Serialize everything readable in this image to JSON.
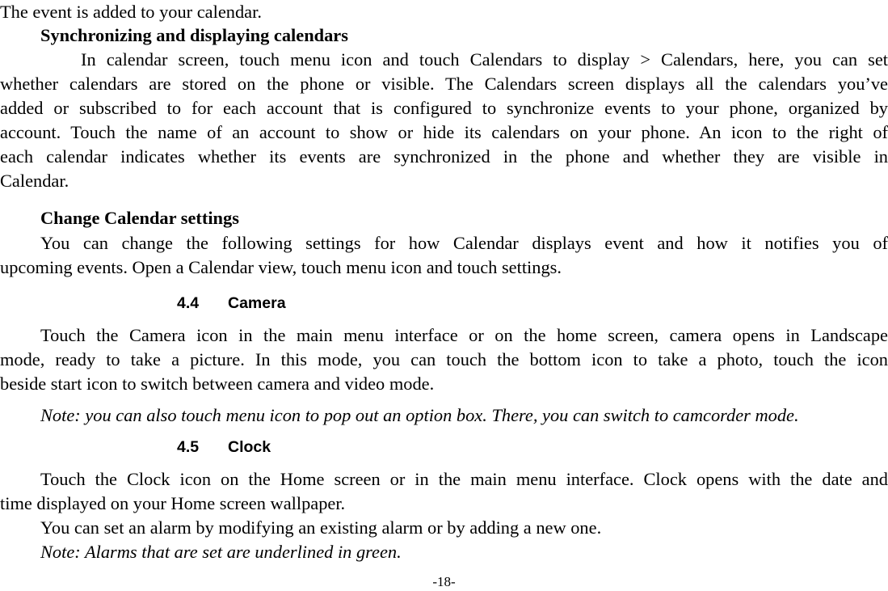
{
  "page": {
    "number": "-18-"
  },
  "intro": {
    "line": "The event is added to your calendar."
  },
  "sync": {
    "heading": "Synchronizing and displaying calendars",
    "lines": [
      "In calendar screen, touch menu icon and touch Calendars to display > Calendars, here, you can set",
      "whether calendars are stored on the phone or visible. The Calendars screen displays all the calendars you’ve",
      "added or subscribed to for each account that is configured to synchronize events to your phone, organized by",
      "account. Touch the name of an account to show or hide its calendars on your phone. An icon to the right of",
      "each calendar indicates whether its events are synchronized in the phone and whether they are visible in",
      "Calendar."
    ]
  },
  "settings": {
    "heading": "Change Calendar settings",
    "lines": [
      "You can change the following settings for how Calendar displays event and how it notifies you of",
      "upcoming events. Open a Calendar view, touch menu icon and touch settings."
    ]
  },
  "camera": {
    "number": "4.4",
    "title": "Camera",
    "lines": [
      "Touch the Camera icon in the main menu interface or on the home screen, camera opens in Landscape",
      "mode, ready to take a picture. In this mode, you can touch the bottom icon to take a photo, touch the icon",
      "beside start icon to switch between camera and video mode."
    ],
    "note": "Note: you can also touch menu icon to pop out an option box. There, you can switch to camcorder mode."
  },
  "clock": {
    "number": "4.5",
    "title": "Clock",
    "lines": [
      "Touch the Clock icon on the Home screen or in the main menu interface. Clock opens with the date and",
      "time displayed on your Home screen wallpaper."
    ],
    "alarm_line": "You can set an alarm by modifying an existing alarm or by adding a new one.",
    "note": "Note: Alarms that are set are underlined in green."
  }
}
